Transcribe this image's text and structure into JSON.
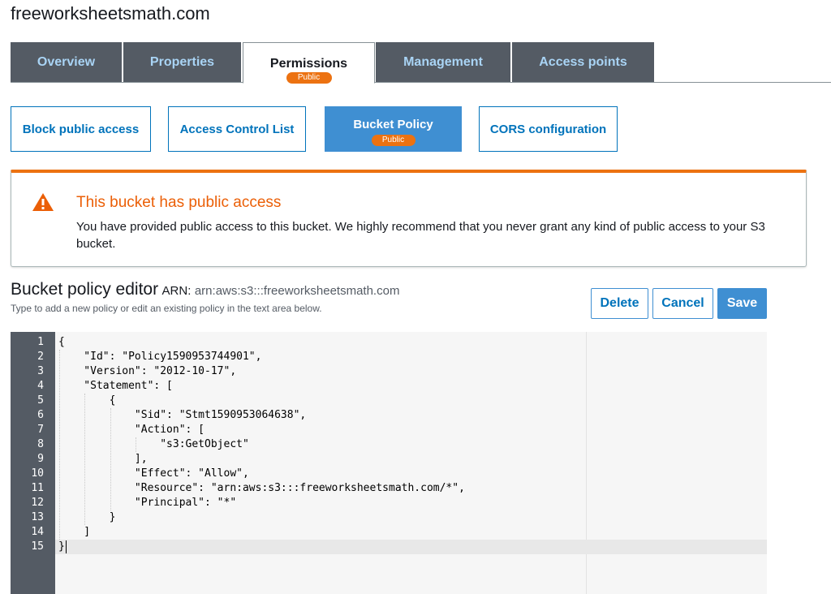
{
  "bucket_name": "freeworksheetsmath.com",
  "main_tabs": [
    {
      "label": "Overview"
    },
    {
      "label": "Properties"
    },
    {
      "label": "Permissions",
      "badge": "Public"
    },
    {
      "label": "Management"
    },
    {
      "label": "Access points"
    }
  ],
  "sub_tabs": [
    {
      "label": "Block public access"
    },
    {
      "label": "Access Control List"
    },
    {
      "label": "Bucket Policy",
      "badge": "Public"
    },
    {
      "label": "CORS configuration"
    }
  ],
  "alert": {
    "title": "This bucket has public access",
    "body": "You have provided public access to this bucket. We highly recommend that you never grant any kind of public access to your S3 bucket.",
    "icon": "warning-triangle-icon",
    "color": "#ec7211"
  },
  "editor": {
    "title": "Bucket policy editor",
    "arn_label": "ARN:",
    "arn_value": "arn:aws:s3:::freeworksheetsmath.com",
    "help": "Type to add a new policy or edit an existing policy in the text area below.",
    "active_line": 15,
    "lines": [
      "{",
      "    \"Id\": \"Policy1590953744901\",",
      "    \"Version\": \"2012-10-17\",",
      "    \"Statement\": [",
      "        {",
      "            \"Sid\": \"Stmt1590953064638\",",
      "            \"Action\": [",
      "                \"s3:GetObject\"",
      "            ],",
      "            \"Effect\": \"Allow\",",
      "            \"Resource\": \"arn:aws:s3:::freeworksheetsmath.com/*\",",
      "            \"Principal\": \"*\"",
      "        }",
      "    ]",
      "}"
    ]
  },
  "buttons": {
    "delete": "Delete",
    "cancel": "Cancel",
    "save": "Save"
  },
  "colors": {
    "accent": "#0073bb",
    "tab_dark": "#545b64",
    "warning": "#ec7211",
    "primary_button": "#3f8fd2"
  }
}
